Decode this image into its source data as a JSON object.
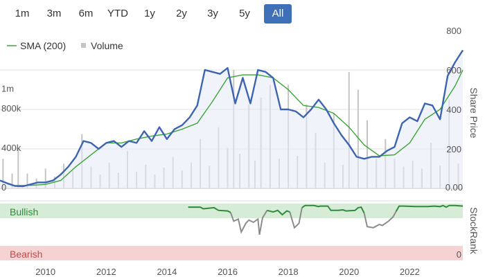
{
  "range_selector": {
    "buttons": [
      {
        "label": "1m"
      },
      {
        "label": "3m"
      },
      {
        "label": "6m"
      },
      {
        "label": "YTD"
      },
      {
        "label": "1y"
      },
      {
        "label": "2y"
      },
      {
        "label": "3y"
      },
      {
        "label": "5y"
      },
      {
        "label": "All"
      }
    ],
    "active": "All"
  },
  "colors": {
    "price": "#3c64b1",
    "sma": "#3aa535",
    "volume": "#c4c4c4",
    "bullish_band": "#d6ecd6",
    "bearish_band": "#f6d3d3",
    "bullish_text": "#2e8b3a",
    "bearish_text": "#c84848",
    "rank_bull": "#2e8b3a",
    "rank_neutral": "#8c8c8c"
  },
  "chart_data": {
    "type": "line",
    "legend": [
      {
        "name": "SMA (200)",
        "marker": "line"
      },
      {
        "name": "Volume",
        "marker": "square"
      }
    ],
    "x_ticks": [
      "2010",
      "2012",
      "2014",
      "2016",
      "2018",
      "2020",
      "2022"
    ],
    "x_range": [
      2008.5,
      2023.75
    ],
    "price_axis": {
      "title": "Share Price",
      "ticks": [
        "200",
        "400",
        "600",
        "800"
      ],
      "range": [
        0,
        800
      ],
      "zero_label": "0.00"
    },
    "volume_axis": {
      "ticks": [
        "0",
        "400k",
        "800k",
        "1m"
      ],
      "range": [
        0,
        1600000
      ]
    },
    "rank_axis": {
      "title": "StockRank",
      "ticks": [
        "0"
      ]
    },
    "zones": {
      "bullish": "Bullish",
      "bearish": "Bearish"
    },
    "price": {
      "x": [
        2008.5,
        2008.75,
        2009.0,
        2009.25,
        2009.5,
        2009.75,
        2010.0,
        2010.25,
        2010.5,
        2010.75,
        2011.0,
        2011.25,
        2011.5,
        2011.75,
        2012.0,
        2012.25,
        2012.5,
        2012.75,
        2013.0,
        2013.25,
        2013.5,
        2013.75,
        2014.0,
        2014.25,
        2014.5,
        2014.75,
        2015.0,
        2015.25,
        2015.5,
        2015.75,
        2016.0,
        2016.25,
        2016.5,
        2016.75,
        2017.0,
        2017.25,
        2017.5,
        2017.75,
        2018.0,
        2018.25,
        2018.5,
        2018.75,
        2019.0,
        2019.25,
        2019.5,
        2019.75,
        2020.0,
        2020.25,
        2020.5,
        2020.75,
        2021.0,
        2021.25,
        2021.5,
        2021.75,
        2022.0,
        2022.25,
        2022.5,
        2022.75,
        2023.0,
        2023.25,
        2023.5,
        2023.75
      ],
      "y": [
        40,
        25,
        12,
        10,
        20,
        30,
        30,
        40,
        70,
        110,
        160,
        240,
        230,
        200,
        230,
        240,
        210,
        240,
        230,
        290,
        240,
        310,
        250,
        300,
        320,
        360,
        420,
        600,
        590,
        580,
        610,
        430,
        560,
        430,
        600,
        590,
        560,
        400,
        400,
        390,
        360,
        400,
        450,
        400,
        330,
        270,
        220,
        160,
        150,
        160,
        160,
        190,
        210,
        330,
        360,
        340,
        430,
        420,
        350,
        570,
        640,
        700
      ]
    },
    "sma": {
      "x": [
        2008.75,
        2009.0,
        2009.5,
        2010.0,
        2010.5,
        2011.0,
        2011.5,
        2012.0,
        2012.5,
        2013.0,
        2013.5,
        2014.0,
        2014.5,
        2015.0,
        2015.5,
        2016.0,
        2016.5,
        2017.0,
        2017.5,
        2018.0,
        2018.5,
        2019.0,
        2019.5,
        2020.0,
        2020.5,
        2021.0,
        2021.5,
        2022.0,
        2022.5,
        2023.0,
        2023.5,
        2023.75
      ],
      "y": [
        22,
        14,
        15,
        20,
        40,
        110,
        170,
        230,
        230,
        250,
        265,
        275,
        300,
        330,
        440,
        560,
        575,
        575,
        560,
        500,
        420,
        410,
        380,
        310,
        220,
        165,
        170,
        230,
        350,
        400,
        520,
        600
      ]
    },
    "volume": {
      "x": [
        2008.6,
        2008.9,
        2009.1,
        2009.4,
        2009.7,
        2010.0,
        2010.3,
        2010.6,
        2010.9,
        2011.2,
        2011.5,
        2011.8,
        2012.1,
        2012.4,
        2012.7,
        2013.0,
        2013.3,
        2013.6,
        2013.9,
        2014.2,
        2014.5,
        2014.8,
        2015.1,
        2015.4,
        2015.7,
        2016.0,
        2016.2,
        2016.4,
        2016.7,
        2016.9,
        2017.1,
        2017.4,
        2017.7,
        2018.0,
        2018.3,
        2018.6,
        2018.9,
        2019.2,
        2019.5,
        2019.8,
        2020.0,
        2020.3,
        2020.6,
        2020.9,
        2021.2,
        2021.5,
        2021.8,
        2022.1,
        2022.4,
        2022.7,
        2023.0,
        2023.3,
        2023.6
      ],
      "y": [
        300000,
        150000,
        400000,
        150000,
        100000,
        200000,
        120000,
        250000,
        180000,
        550000,
        220000,
        140000,
        260000,
        160000,
        380000,
        170000,
        240000,
        140000,
        210000,
        320000,
        180000,
        260000,
        500000,
        230000,
        620000,
        410000,
        1200000,
        350000,
        850000,
        280000,
        920000,
        1050000,
        300000,
        1050000,
        330000,
        850000,
        560000,
        260000,
        760000,
        240000,
        1180000,
        1000000,
        690000,
        300000,
        500000,
        300000,
        220000,
        280000,
        200000,
        460000,
        230000,
        900000,
        250000
      ]
    },
    "stockrank": {
      "bull_segments": [
        {
          "x": [
            2014.7,
            2015.1,
            2015.2,
            2015.55,
            2015.7,
            2016.0,
            2016.1
          ],
          "y": [
            96,
            96,
            93,
            95,
            90,
            89,
            86
          ]
        },
        {
          "x": [
            2017.3,
            2017.5,
            2017.65,
            2017.8,
            2017.95,
            2018.05
          ],
          "y": [
            90,
            87,
            90,
            82,
            89,
            87
          ]
        },
        {
          "x": [
            2018.45,
            2018.55,
            2018.85,
            2019.0,
            2019.05,
            2019.3,
            2019.4,
            2019.65,
            2019.8,
            2019.9,
            2020.2,
            2020.3,
            2020.4,
            2020.5
          ],
          "y": [
            95,
            99,
            99,
            97,
            98,
            98,
            90,
            90,
            91,
            89,
            90,
            95,
            96,
            85
          ]
        },
        {
          "x": [
            2021.55,
            2021.65,
            2021.8,
            2022.2,
            2022.6,
            2022.8,
            2023.0,
            2023.1,
            2023.2,
            2023.3,
            2023.5,
            2023.75
          ],
          "y": [
            88,
            98,
            98,
            97,
            97,
            98,
            97,
            99,
            96,
            99,
            99,
            98
          ]
        }
      ],
      "neutral_segments": [
        {
          "x": [
            2016.1,
            2016.2,
            2016.35,
            2016.45,
            2016.6,
            2016.7,
            2016.85,
            2017.0,
            2017.05,
            2017.15,
            2017.3
          ],
          "y": [
            86,
            70,
            74,
            50,
            66,
            72,
            68,
            74,
            45,
            76,
            90
          ]
        },
        {
          "x": [
            2018.05,
            2018.2,
            2018.35,
            2018.45
          ],
          "y": [
            87,
            58,
            66,
            95
          ]
        },
        {
          "x": [
            2020.5,
            2020.6,
            2020.8,
            2021.0,
            2021.1,
            2021.3,
            2021.45,
            2021.55
          ],
          "y": [
            85,
            60,
            58,
            64,
            62,
            70,
            78,
            88
          ]
        }
      ],
      "range": [
        0,
        100
      ]
    }
  }
}
